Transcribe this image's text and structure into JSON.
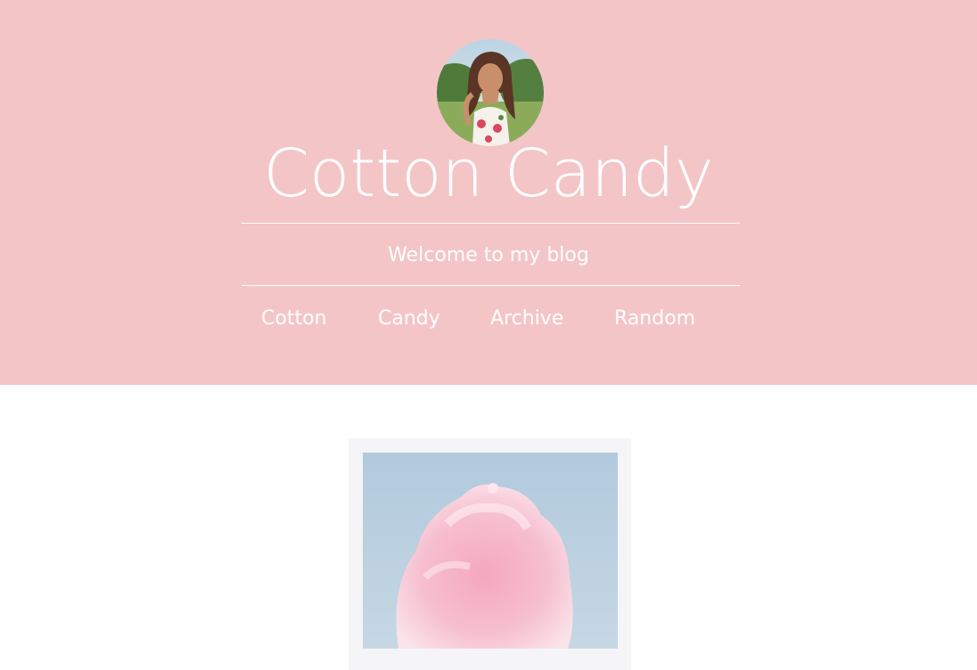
{
  "blog": {
    "title": "Cotton Candy",
    "description": "Welcome to my blog"
  },
  "nav": {
    "items": [
      {
        "label": "Cotton"
      },
      {
        "label": "Candy"
      },
      {
        "label": "Archive"
      },
      {
        "label": "Random"
      }
    ]
  },
  "colors": {
    "header_bg": "#f4c5c7",
    "text": "#ffffff",
    "post_frame": "#f5f4f6",
    "page_bg": "#ffffff"
  },
  "images": {
    "avatar": "profile-photo",
    "post": "cotton-candy-photo"
  }
}
